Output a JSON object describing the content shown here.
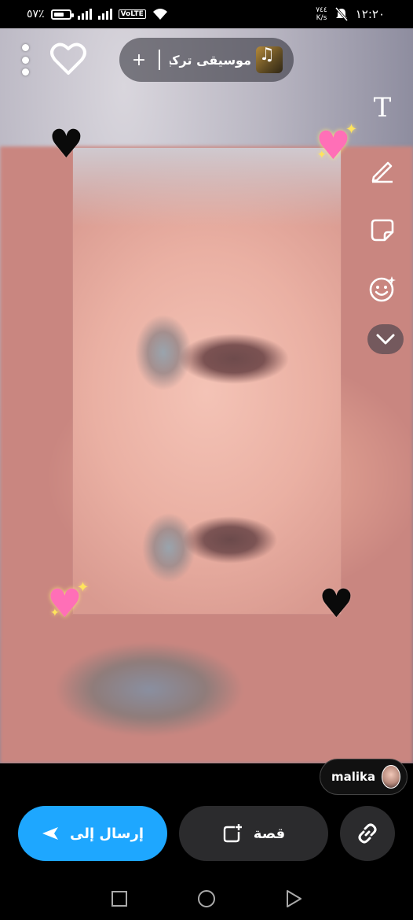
{
  "status_bar": {
    "battery": "٥٧٪",
    "time": "١٢:٢٠",
    "speed_value": "٧٤٤",
    "speed_unit": "K/s",
    "volte": "VoLTE",
    "signal_icon": "signal-icon",
    "wifi_icon": "wifi-icon",
    "mute_icon": "bell-off-icon"
  },
  "top_bar": {
    "music_title": "موسيقى تركية...",
    "music_plus": "+",
    "heart_icon": "heart-outline-icon",
    "menu_icon": "more-vertical-icon"
  },
  "tools": {
    "text_tool": "T",
    "pen_icon": "pen-icon",
    "sticker_icon": "sticker-icon",
    "emoji_icon": "smiley-icon",
    "more_icon": "chevron-down-icon"
  },
  "stickers": {
    "black_heart": "🖤",
    "pink_heart": "💖",
    "sparkle": "✦"
  },
  "bottom": {
    "username": "malika",
    "send_label": "إرسال إلى",
    "story_label": "قصة",
    "link_icon": "link-icon",
    "send_color": "#1ea7ff"
  },
  "nav": {
    "recents_icon": "square-icon",
    "home_icon": "circle-icon",
    "back_icon": "triangle-back-icon"
  }
}
